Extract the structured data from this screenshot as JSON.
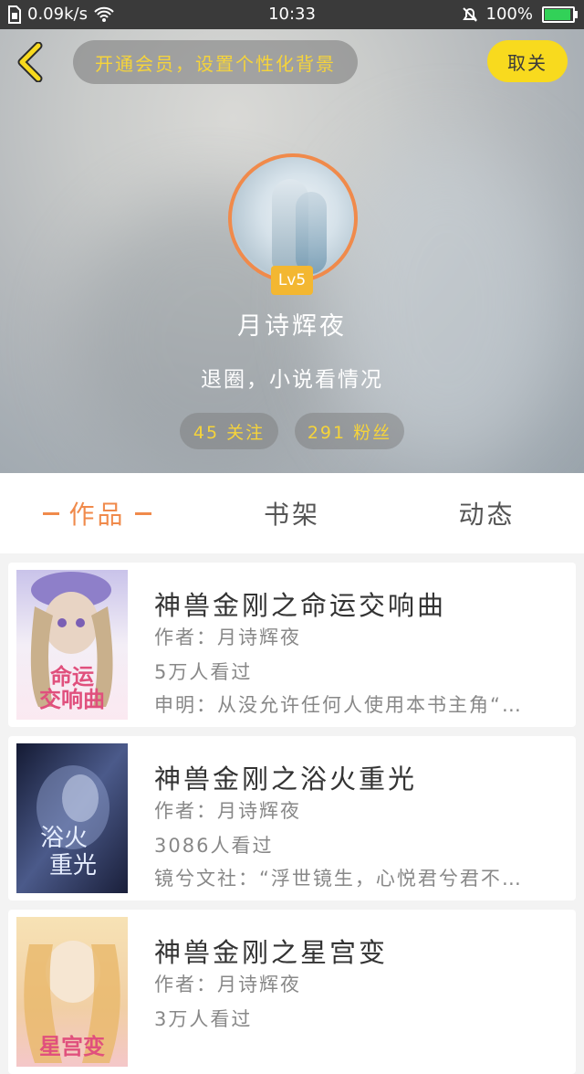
{
  "status_bar": {
    "speed": "0.09k/s",
    "time": "10:33",
    "battery": "100%",
    "battery_level": 1.0
  },
  "header": {
    "vip_text": "开通会员，设置个性化背景",
    "unfollow_label": "取关"
  },
  "profile": {
    "level": "Lv5",
    "username": "月诗辉夜",
    "bio": "退圈，小说看情况",
    "following": "45 关注",
    "followers": "291 粉丝"
  },
  "tabs": [
    {
      "label": "作品",
      "active": true
    },
    {
      "label": "书架",
      "active": false
    },
    {
      "label": "动态",
      "active": false
    }
  ],
  "books": [
    {
      "title": "神兽金刚之命运交响曲",
      "author": "作者：月诗辉夜",
      "views": "5万人看过",
      "desc": "申明：从没允许任何人使用本书主角“…",
      "cover_text": "命运交响曲"
    },
    {
      "title": "神兽金刚之浴火重光",
      "author": "作者：月诗辉夜",
      "views": "3086人看过",
      "desc": "镜兮文社：“浮世镜生，心悦君兮君不…",
      "cover_text": "浴火重光"
    },
    {
      "title": "神兽金刚之星宫变",
      "author": "作者：月诗辉夜",
      "views": "3万人看过",
      "desc": "",
      "cover_text": "星宫变"
    }
  ],
  "colors": {
    "accent": "#f08a4b",
    "yellow": "#f8da1e",
    "badge": "#f3b731"
  }
}
